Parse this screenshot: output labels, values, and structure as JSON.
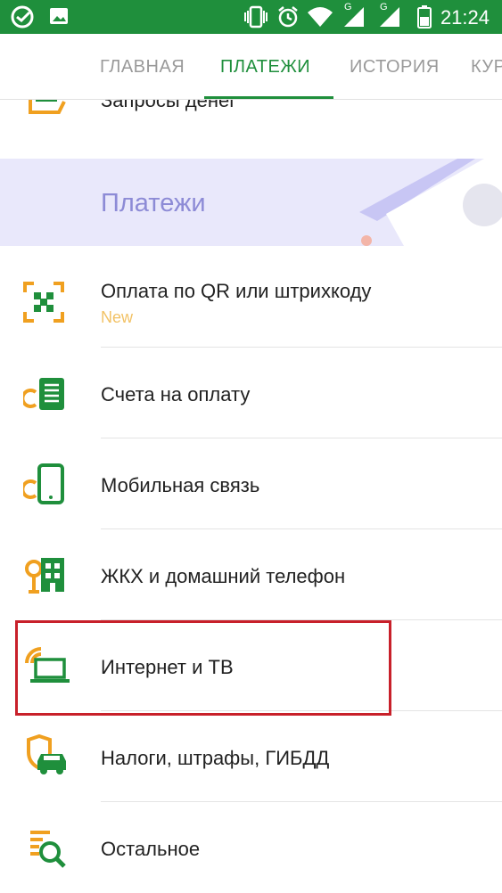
{
  "status_bar": {
    "time": "21:24",
    "signal_labels": [
      "G",
      "G"
    ]
  },
  "tabs": [
    {
      "label": "ГЛАВНАЯ",
      "active": false
    },
    {
      "label": "ПЛАТЕЖИ",
      "active": true
    },
    {
      "label": "ИСТОРИЯ",
      "active": false
    },
    {
      "label": "КУРСЫ",
      "active": false
    }
  ],
  "partial_item": {
    "label": "Запросы денег"
  },
  "section": {
    "title": "Платежи"
  },
  "items": [
    {
      "label": "Оплата по QR или штрихкоду",
      "badge": "New",
      "icon": "qr-code-icon"
    },
    {
      "label": "Счета на оплату",
      "icon": "bill-icon"
    },
    {
      "label": "Мобильная связь",
      "icon": "mobile-phone-icon"
    },
    {
      "label": "ЖКХ и домашний телефон",
      "icon": "building-icon"
    },
    {
      "label": "Интернет и ТВ",
      "icon": "laptop-wifi-icon"
    },
    {
      "label": "Налоги, штрафы, ГИБДД",
      "icon": "car-shield-icon"
    },
    {
      "label": "Остальное",
      "icon": "search-list-icon"
    }
  ],
  "colors": {
    "brand_green": "#1f8f3c",
    "icon_orange": "#f0a020",
    "highlight_red": "#c8202a",
    "banner_bg": "#e9e8fb"
  }
}
